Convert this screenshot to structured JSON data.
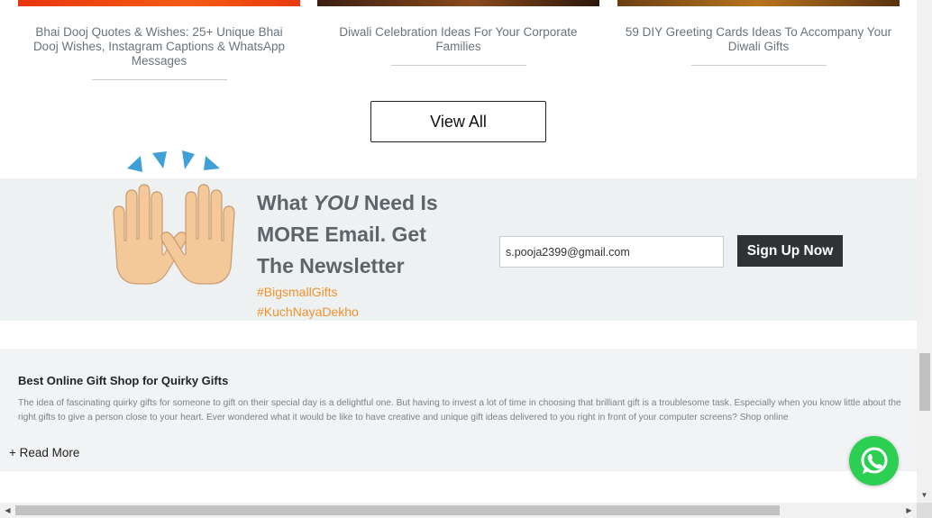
{
  "blog": {
    "cards": [
      {
        "title": "Bhai Dooj Quotes & Wishes: 25+ Unique Bhai Dooj Wishes, Instagram Captions & WhatsApp Messages"
      },
      {
        "title": "Diwali Celebration Ideas For Your Corporate Families"
      },
      {
        "title": "59 DIY Greeting Cards Ideas To Accompany Your Diwali Gifts"
      }
    ],
    "view_all_label": "View All"
  },
  "newsletter": {
    "title_prefix": "What ",
    "title_emphasis": "YOU",
    "title_suffix": " Need Is MORE Email. Get The Newsletter",
    "tags": [
      "#BigsmallGifts",
      "#KuchNayaDekho"
    ],
    "email_value": "s.pooja2399@gmail.com",
    "signup_label": "Sign Up Now",
    "icon": "raised-hands-icon"
  },
  "seo": {
    "title": "Best Online Gift Shop for Quirky Gifts",
    "text": "The idea of fascinating quirky gifts for someone to gift on their special day is a delightful one. But having to invest a lot of time in choosing that brilliant gift is a troublesome task. Especially when you know little about the right gifts to give a person close to your heart. Ever wondered what it would be like to have creative and unique gift ideas delivered to you right in front of your computer screens? Shop online",
    "read_more_label": "+ Read More"
  },
  "colors": {
    "accent_tag": "#f0922b",
    "signup_bg": "#2f3336",
    "newsletter_bg": "#eef1f2",
    "whatsapp": "#2ccf52"
  }
}
